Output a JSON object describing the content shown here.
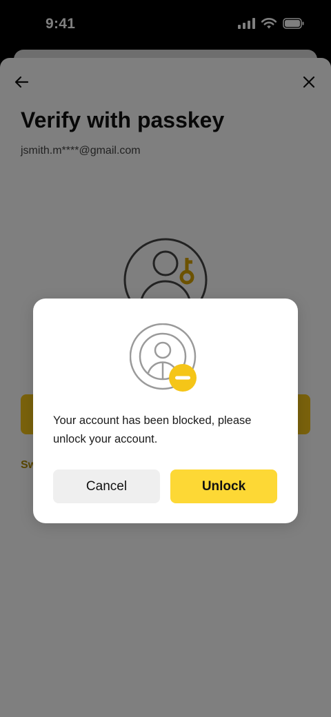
{
  "status_bar": {
    "time": "9:41"
  },
  "screen": {
    "title": "Verify with passkey",
    "email": "jsmith.m****@gmail.com",
    "switch_link": "Sw"
  },
  "dialog": {
    "message": "Your account has been blocked, please unlock your account.",
    "cancel_label": "Cancel",
    "unlock_label": "Unlock"
  },
  "colors": {
    "accent": "#fdd835",
    "primary_button": "#f5c518",
    "scrim": "#808080"
  },
  "icons": {
    "back": "arrow-left-icon",
    "close": "close-icon",
    "passkey": "user-key-icon",
    "blocked": "user-blocked-icon"
  }
}
